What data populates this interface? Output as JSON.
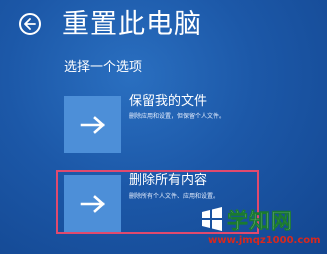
{
  "header": {
    "back_icon": "back-arrow-icon",
    "title": "重置此电脑"
  },
  "subtitle": "选择一个选项",
  "options": [
    {
      "icon": "arrow-right-icon",
      "title": "保留我的文件",
      "description": "删除应用和设置，但保留个人文件。"
    },
    {
      "icon": "arrow-right-icon",
      "title": "删除所有内容",
      "description": "删除所有个人文件、应用和设置。",
      "highlight_color": "#e04a6e"
    }
  ],
  "watermark": {
    "name": "学知网",
    "url": "www.jmqz1000.com"
  },
  "colors": {
    "background": "#1c58a8",
    "tile": "#4d8fd8"
  }
}
